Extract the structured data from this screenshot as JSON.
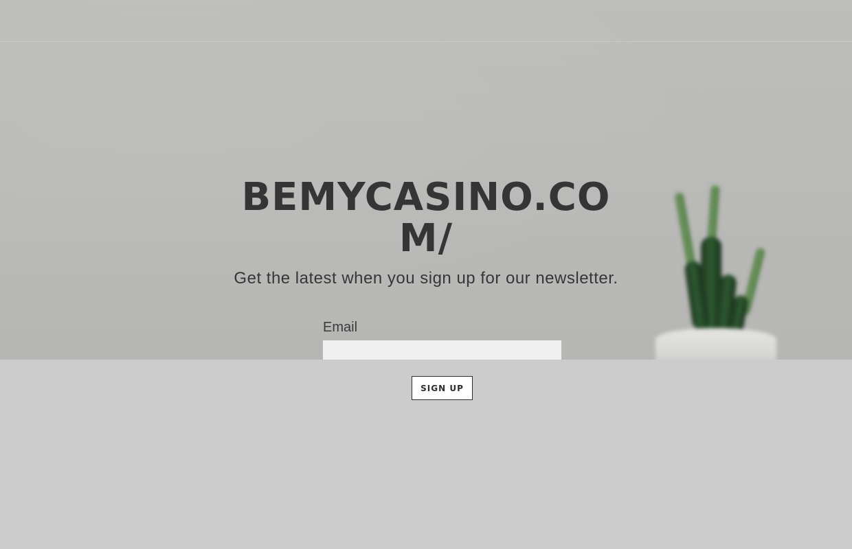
{
  "site": {
    "title": "BEMYCASINO.COM/",
    "tagline": "Get the latest when you sign up for our newsletter."
  },
  "form": {
    "email_label": "Email",
    "email_value": "",
    "signup_label": "SIGN UP"
  },
  "colors": {
    "hero_background": "#bbbbb9",
    "page_background": "#cccccc",
    "title_text": "#353535",
    "button_border": "#2c2c2c",
    "input_background": "#f0f0f0"
  }
}
